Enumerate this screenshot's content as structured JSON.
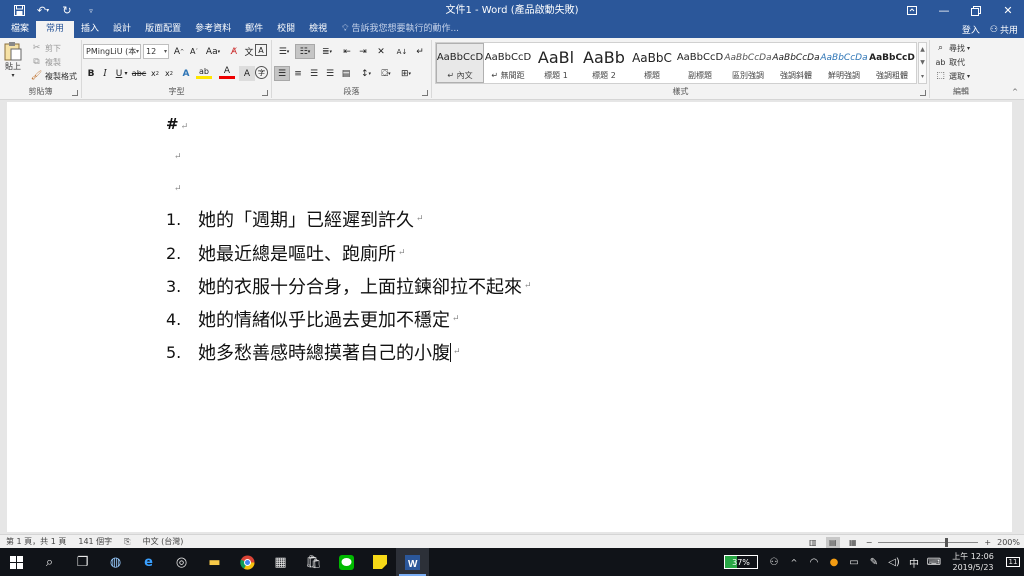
{
  "window": {
    "title": "文件1 - Word (產品啟動失敗)"
  },
  "qat": {
    "save_icon": "save-icon",
    "undo_icon": "undo-icon",
    "redo_icon": "redo-icon",
    "customize_icon": "customize-icon"
  },
  "tabs": [
    "檔案",
    "常用",
    "插入",
    "設計",
    "版面配置",
    "參考資料",
    "郵件",
    "校閱",
    "檢視"
  ],
  "active_tab": "常用",
  "tell_me": "告訴我您想要執行的動作...",
  "account": {
    "sign_in": "登入",
    "share": "共用"
  },
  "ribbon": {
    "clipboard": {
      "label": "剪貼簿",
      "paste": "貼上",
      "cut": "剪下",
      "copy": "複製",
      "format_painter": "複製格式"
    },
    "font": {
      "label": "字型",
      "font_name": "PMingLiU (本",
      "font_size": "12"
    },
    "paragraph": {
      "label": "段落"
    },
    "styles": {
      "label": "樣式",
      "items": [
        {
          "sample": "AaBbCcD",
          "name": "↵ 內文"
        },
        {
          "sample": "AaBbCcD",
          "name": "↵ 無間距"
        },
        {
          "sample": "AaBl",
          "name": "標題 1"
        },
        {
          "sample": "AaBb",
          "name": "標題 2"
        },
        {
          "sample": "AaBbC",
          "name": "標題"
        },
        {
          "sample": "AaBbCcD",
          "name": "副標題"
        },
        {
          "sample": "AaBbCcDa",
          "name": "區別強調"
        },
        {
          "sample": "AaBbCcDa",
          "name": "強調斜體"
        },
        {
          "sample": "AaBbCcDa",
          "name": "鮮明強調"
        },
        {
          "sample": "AaBbCcD",
          "name": "強調粗體"
        }
      ]
    },
    "editing": {
      "label": "編輯",
      "find": "尋找",
      "replace": "取代",
      "select": "選取"
    }
  },
  "document": {
    "heading": "#",
    "paragraph_mark": "↵",
    "list": [
      {
        "num": "1.",
        "text": "她的「週期」已經遲到許久"
      },
      {
        "num": "2.",
        "text": "她最近總是嘔吐、跑廁所"
      },
      {
        "num": "3.",
        "text": "她的衣服十分合身，上面拉鍊卻拉不起來"
      },
      {
        "num": "4.",
        "text": "她的情緒似乎比過去更加不穩定"
      },
      {
        "num": "5.",
        "text": "她多愁善感時總摸著自己的小腹"
      }
    ]
  },
  "status": {
    "page": "第 1 頁，共 1 頁",
    "words": "141 個字",
    "language": "中文 (台灣)",
    "zoom": "200%",
    "zoom_fraction": 0.67
  },
  "taskbar": {
    "battery": "37%",
    "battery_level": 0.37,
    "ime": "中",
    "time": "上午 12:06",
    "date": "2019/5/23",
    "notifications": "11"
  }
}
